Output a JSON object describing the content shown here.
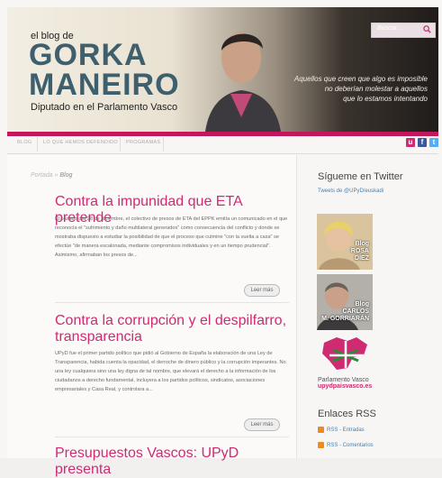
{
  "header": {
    "blog_of": "el blog de",
    "name_line1": "GORKA",
    "name_line2": "MANEIRO",
    "subtitle": "Diputado en el Parlamento Vasco",
    "search_placeholder": "Buscar...",
    "quote_line1": "Aquellos que creen que algo es imposible",
    "quote_line2": "no deberían molestar a aquellos",
    "quote_line3": "que lo estamos intentando"
  },
  "nav": {
    "items": [
      "BLOG",
      "LO QUE HEMOS DEFENDIDO",
      "PROGRAMAS"
    ]
  },
  "social": [
    "upyd",
    "facebook",
    "twitter"
  ],
  "colors": {
    "accent": "#d02a73",
    "brand": "#c2185b",
    "link": "#4a7fae"
  },
  "breadcrumb": {
    "home": "Portada",
    "sep": "»",
    "current": "Blog"
  },
  "posts": [
    {
      "title": "Contra la impunidad que ETA pretende",
      "excerpt": "El pasado día 28 de diciembre, el colectivo de presos de ETA del EPPK emitía un comunicado en el que reconocía el \"sufrimiento y daño multilateral generados\" como consecuencia del conflicto y donde se mostraba dispuesto a estudiar la posibilidad de que el proceso que culmine \"con la vuelta a casa\" se efectúe \"de manera escalonada, mediante compromisos individuales y en un tiempo prudencial\". Asimismo, afirmaban los presos de...",
      "more": "Leer más"
    },
    {
      "title_line1": "Contra la corrupción y el despilfarro,",
      "title_line2": "transparencia",
      "excerpt": "UPyD fue el primer partido político que pidió al Gobierno de España la elaboración de una Ley de Transparencia, habida cuenta la opacidad, el derroche de dinero público y la corrupción imperantes. No una ley cualquiera sino una ley digna de tal nombre, que elevará el derecho a la información de los ciudadanos a derecho fundamental, incluyera a los partidos políticos, sindicatos, asociaciones empresariales y Casa Real, y controlara a...",
      "more": "Leer más"
    },
    {
      "title": "Presupuestos Vascos: UPyD presenta"
    }
  ],
  "sidebar": {
    "twitter_heading": "Sígueme en Twitter",
    "twitter_link": "Tweets de @UPyD/euskadi",
    "blog1_label1": "Blog",
    "blog1_label2": "ROSA",
    "blog1_label3": "DÍEZ",
    "blog2_label1": "Blog",
    "blog2_label2": "CARLOS",
    "blog2_label3": "M. GORRIARÁN",
    "pv_label": "Parlamento Vasco",
    "pv_site": "upydpaisvasco.es",
    "rss_heading": "Enlaces RSS",
    "rss_items": [
      "RSS - Entradas",
      "RSS - Comentarios"
    ]
  }
}
